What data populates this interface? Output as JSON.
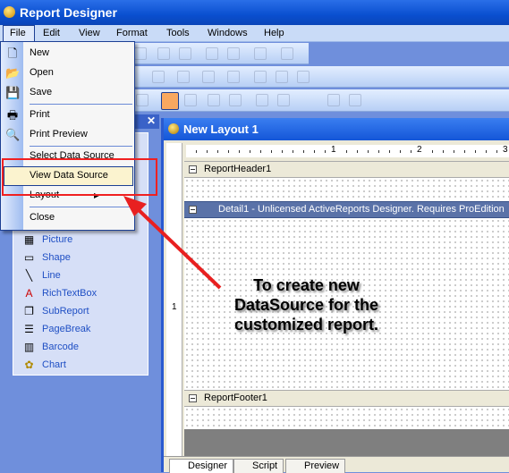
{
  "app": {
    "title": "Report Designer"
  },
  "menubar": [
    "File",
    "Edit",
    "View",
    "Format",
    "Tools",
    "Windows",
    "Help"
  ],
  "file_menu": [
    {
      "label": "New",
      "icon": "new-document-icon"
    },
    {
      "label": "Open",
      "icon": "open-folder-icon"
    },
    {
      "label": "Save",
      "icon": "save-icon"
    },
    {
      "label": "Print",
      "icon": "printer-icon"
    },
    {
      "label": "Print Preview",
      "icon": "print-preview-icon"
    },
    {
      "label": "Select Data Source"
    },
    {
      "label": "View Data Source",
      "highlighted": true
    },
    {
      "label": "Layout",
      "submenu": true
    },
    {
      "label": "Close"
    }
  ],
  "toolbox": {
    "items": [
      {
        "label": "Picture",
        "icon": "picture-icon"
      },
      {
        "label": "Shape",
        "icon": "shape-icon"
      },
      {
        "label": "Line",
        "icon": "line-icon"
      },
      {
        "label": "RichTextBox",
        "icon": "richtextbox-icon"
      },
      {
        "label": "SubReport",
        "icon": "subreport-icon"
      },
      {
        "label": "PageBreak",
        "icon": "pagebreak-icon"
      },
      {
        "label": "Barcode",
        "icon": "barcode-icon"
      },
      {
        "label": "Chart",
        "icon": "chart-icon"
      }
    ]
  },
  "layout": {
    "title": "New Layout 1",
    "ruler": [
      "1",
      "2",
      "3"
    ],
    "vruler": "1",
    "bands": {
      "header": "ReportHeader1",
      "detail": "Detail1   -   Unlicensed ActiveReports Designer. Requires ProEdition",
      "footer": "ReportFooter1"
    },
    "tabs": [
      "Designer",
      "Script",
      "Preview"
    ]
  },
  "annotation": "To create new DataSource for the customized report.",
  "colors": {
    "highlight_box": "#f02020",
    "arrow": "#e82020",
    "titlebar": "#0a4fd0"
  }
}
